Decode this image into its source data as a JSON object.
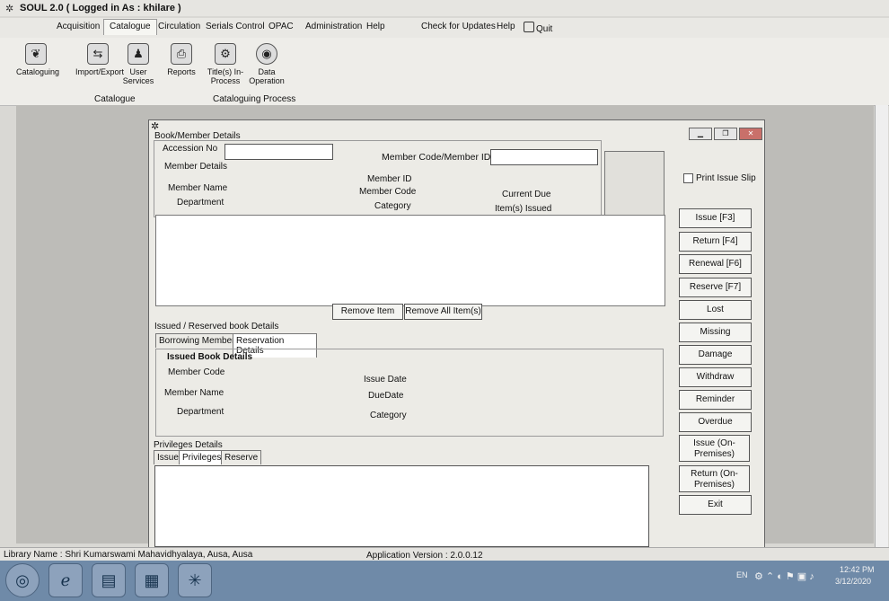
{
  "window": {
    "title": "SOUL 2.0  ( Logged in As : khilare )"
  },
  "menu": {
    "items": [
      "Acquisition",
      "Catalogue",
      "Circulation",
      "Serials Control",
      "OPAC",
      "Administration",
      "Help",
      "Check for Updates",
      "Help",
      "Quit"
    ]
  },
  "ribbon": {
    "buttons": [
      "Cataloguing",
      "Import/Export",
      "User Services",
      "Reports",
      "Title(s) In-Process",
      "Data Operation"
    ],
    "groups": [
      "Catalogue",
      "Cataloguing Process"
    ]
  },
  "form": {
    "section_title": "Book/Member Details",
    "accession_label": "Accession No",
    "member_code_id_label": "Member Code/Member ID",
    "member_details_label": "Member Details",
    "member_name_label": "Member Name",
    "department_label": "Department",
    "member_id_label": "Member ID",
    "member_code_label": "Member Code",
    "category_label": "Category",
    "current_due_label": "Current Due",
    "items_issued_label": "Item(s) Issued",
    "print_issue_slip": "Print Issue Slip",
    "remove_item": "Remove Item",
    "remove_all": "Remove All Item(s)",
    "issued_reserved_title": "Issued / Reserved book Details",
    "tabs": [
      "Borrowing Member",
      "Reservation Details"
    ],
    "issued_book_details": "Issued Book Details",
    "ib_member_code": "Member Code",
    "ib_member_name": "Member Name",
    "ib_department": "Department",
    "ib_issue_date": "Issue Date",
    "ib_due_date": "DueDate",
    "ib_category": "Category",
    "privileges_title": "Privileges Details",
    "priv_tabs": [
      "Issue",
      "Privileges",
      "Reserve"
    ]
  },
  "side_buttons": [
    "Issue [F3]",
    "Return [F4]",
    "Renewal [F6]",
    "Reserve [F7]",
    "Lost",
    "Missing",
    "Damage",
    "Withdraw",
    "Reminder",
    "Overdue",
    "Issue (On-Premises)",
    "Return (On-Premises)",
    "Exit"
  ],
  "status": {
    "library_name": "Library Name : Shri Kumarswami Mahavidhyalaya, Ausa, Ausa",
    "app_version": "Application Version : 2.0.0.12"
  },
  "taskbar": {
    "lang": "EN",
    "time": "12:42 PM",
    "date": "3/12/2020"
  },
  "icons": [
    "start-orb-icon",
    "browser-icon",
    "explorer-icon",
    "document-icon",
    "soul-app-icon"
  ]
}
